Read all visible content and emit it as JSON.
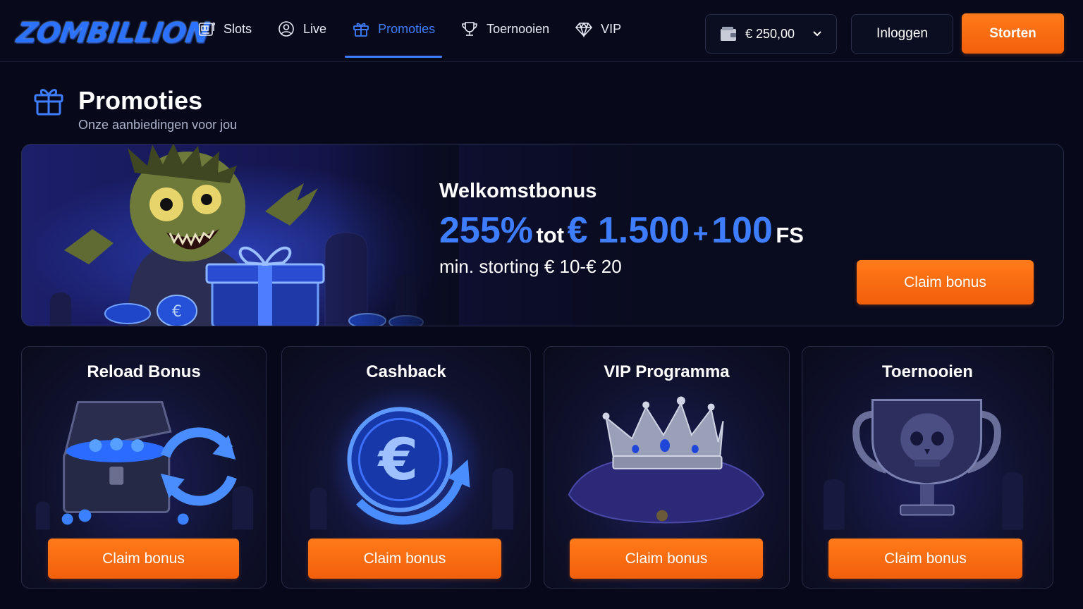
{
  "brand": {
    "logo_text": "ZOMBILLION"
  },
  "nav": {
    "items": [
      {
        "label": "Slots",
        "icon": "slot-machine-icon",
        "active": false
      },
      {
        "label": "Live",
        "icon": "user-circle-icon",
        "active": false
      },
      {
        "label": "Promoties",
        "icon": "gift-icon",
        "active": true
      },
      {
        "label": "Toernooien",
        "icon": "trophy-icon",
        "active": false
      },
      {
        "label": "VIP",
        "icon": "diamond-icon",
        "active": false
      }
    ]
  },
  "account": {
    "balance": "€ 250,00",
    "login_label": "Inloggen",
    "deposit_label": "Storten"
  },
  "page": {
    "title": "Promoties",
    "subtitle": "Onze aanbiedingen voor jou"
  },
  "hero": {
    "title": "Welkomstbonus",
    "percent": "255%",
    "tot": "tot",
    "amount": "€ 1.500",
    "plus": "+",
    "spins": "100",
    "spins_unit": "FS",
    "min_deposit": "min. storting € 10-€ 20",
    "cta": "Claim bonus"
  },
  "cards": [
    {
      "title": "Reload Bonus",
      "cta": "Claim bonus",
      "art": "treasure-chest-icon"
    },
    {
      "title": "Cashback",
      "cta": "Claim bonus",
      "art": "euro-refresh-icon"
    },
    {
      "title": "VIP Programma",
      "cta": "Claim bonus",
      "art": "crown-icon"
    },
    {
      "title": "Toernooien",
      "cta": "Claim bonus",
      "art": "skull-trophy-icon"
    }
  ],
  "colors": {
    "accent_blue": "#3f7dff",
    "cta_orange": "#f86a12",
    "background": "#07091a"
  }
}
